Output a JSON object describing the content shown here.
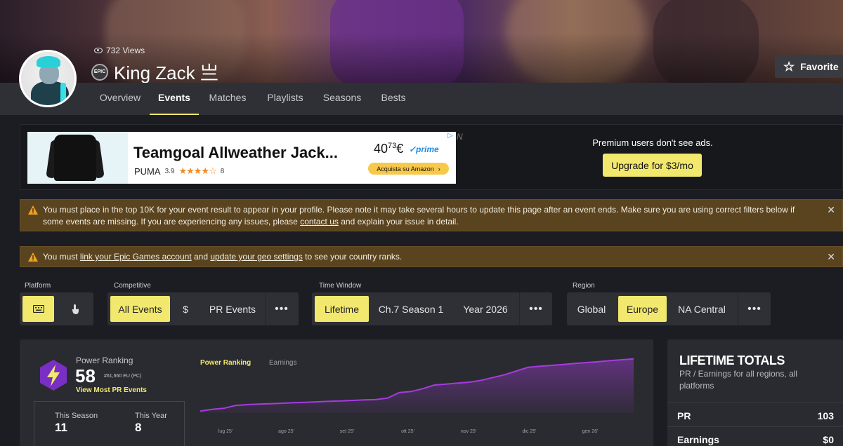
{
  "profile": {
    "views": "732 Views",
    "platform_badge": "EPIC",
    "name": "King Zack 亗",
    "favorite_label": "Favorite"
  },
  "tabs": [
    {
      "label": "Overview"
    },
    {
      "label": "Events",
      "active": true
    },
    {
      "label": "Matches"
    },
    {
      "label": "Playlists"
    },
    {
      "label": "Seasons"
    },
    {
      "label": "Bests"
    }
  ],
  "ad": {
    "title": "Teamgoal Allweather Jack...",
    "brand": "PUMA",
    "rating": "3.9",
    "stars": "★★★★☆",
    "reviews": "8",
    "price_main": "40",
    "price_cents": "73",
    "currency": "€",
    "prime": "✓prime",
    "buy_label": "Acquista su Amazon",
    "buy_chevron": "›",
    "premium_text": "Premium users don't see ads.",
    "upgrade_label": "Upgrade for $3/mo"
  },
  "alerts": {
    "a1_part1": "You must place in the top 10K for your event result to appear in your profile. Please note it may take several hours to update this page after an event ends. Make sure you are using correct filters below if some events are missing. If you are experiencing any issues, please ",
    "a1_link": "contact us",
    "a1_part2": " and explain your issue in detail.",
    "a2_part1": "You must ",
    "a2_link1": "link your Epic Games account",
    "a2_part2": " and ",
    "a2_link2": "update your geo settings",
    "a2_part3": " to see your country ranks.",
    "close": "✕"
  },
  "filters": {
    "platform_label": "Platform",
    "competitive_label": "Competitive",
    "competitive": [
      "All Events",
      "$",
      "PR Events",
      "•••"
    ],
    "time_label": "Time Window",
    "time": [
      "Lifetime",
      "Ch.7 Season 1",
      "Year 2026",
      "•••"
    ],
    "region_label": "Region",
    "region": [
      "Global",
      "Europe",
      "NA Central",
      "•••"
    ]
  },
  "power_ranking": {
    "label": "Power Ranking",
    "value": "58",
    "rank": "#61,660 EU (PC)",
    "link": "View Most PR Events",
    "season_label": "This Season",
    "season_value": "11",
    "year_label": "This Year",
    "year_value": "8",
    "chart_tab_on": "Power Ranking",
    "chart_tab_off": "Earnings"
  },
  "totals": {
    "title": "LIFETIME TOTALS",
    "subtitle": "PR / Earnings for all regions, all platforms",
    "pr_label": "PR",
    "pr_value": "103",
    "earn_label": "Earnings",
    "earn_value": "$0"
  },
  "colors": {
    "accent": "#f2e86d",
    "line": "#a63be0",
    "warning_bg": "#5a4420"
  },
  "chart_data": {
    "type": "area",
    "x": [
      "lug 25'",
      "ago 25'",
      "set 25'",
      "ott 25'",
      "nov 25'",
      "dic 25'",
      "gen 26'"
    ],
    "series": [
      {
        "values": [
          2,
          4,
          5,
          8,
          9,
          9.5,
          10,
          10.5,
          11,
          11.5,
          12,
          12.5,
          13,
          13.5,
          14,
          14.5,
          16,
          22,
          23,
          26,
          30,
          31,
          32,
          33,
          35,
          38,
          41,
          45,
          49,
          50,
          51,
          52,
          53,
          54,
          55,
          56,
          57,
          58
        ]
      }
    ]
  }
}
